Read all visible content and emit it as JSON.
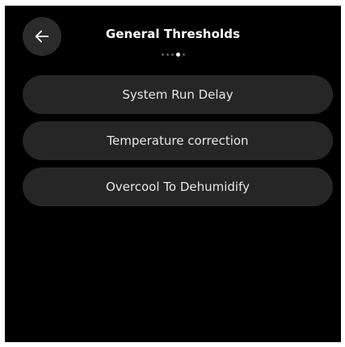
{
  "header": {
    "title": "General Thresholds",
    "back_icon": "arrow-left-icon",
    "pager": {
      "count": 5,
      "active_index": 3
    }
  },
  "menu": {
    "items": [
      {
        "label": "System Run Delay"
      },
      {
        "label": "Temperature correction"
      },
      {
        "label": "Overcool To Dehumidify"
      }
    ]
  },
  "colors": {
    "background": "#000000",
    "button_bg": "#262626",
    "back_button_bg": "#2b2b2b",
    "text": "#ffffff"
  }
}
